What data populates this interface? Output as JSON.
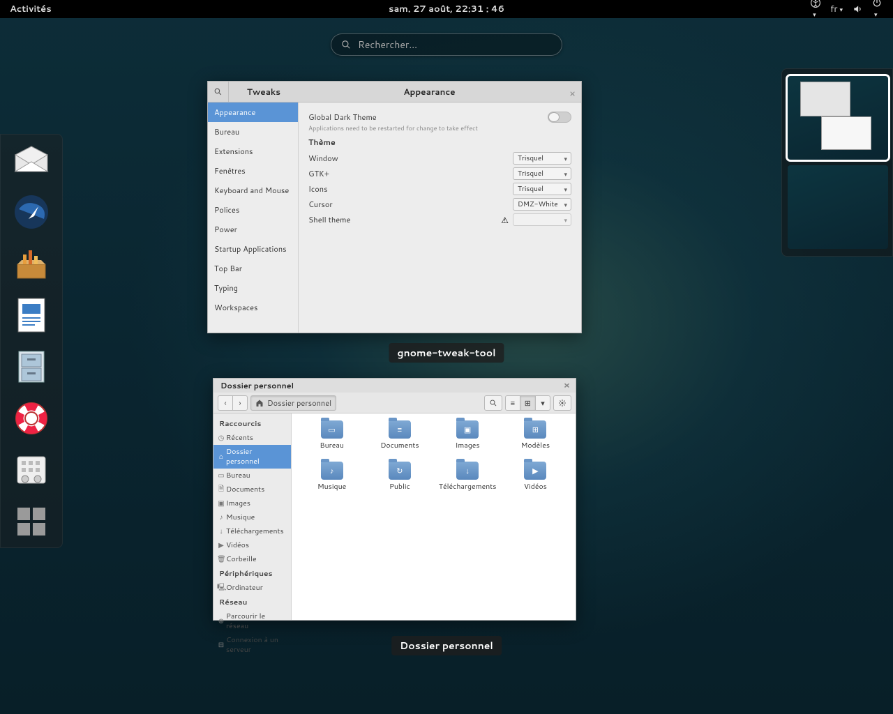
{
  "topbar": {
    "activities": "Activités",
    "clock": "sam. 27 août, 22:31 : 46",
    "lang": "fr"
  },
  "search": {
    "placeholder": "Rechercher..."
  },
  "tweaks": {
    "app_title": "Tweaks",
    "page_title": "Appearance",
    "label": "gnome-tweak-tool",
    "categories": [
      "Appearance",
      "Bureau",
      "Extensions",
      "Fenêtres",
      "Keyboard and Mouse",
      "Polices",
      "Power",
      "Startup Applications",
      "Top Bar",
      "Typing",
      "Workspaces"
    ],
    "global_dark": "Global Dark Theme",
    "global_dark_note": "Applications need to be restarted for change to take effect",
    "theme_header": "Thème",
    "rows": {
      "window": {
        "label": "Window",
        "value": "Trisquel"
      },
      "gtk": {
        "label": "GTK+",
        "value": "Trisquel"
      },
      "icons": {
        "label": "Icons",
        "value": "Trisquel"
      },
      "cursor": {
        "label": "Cursor",
        "value": "DMZ-White"
      },
      "shell": {
        "label": "Shell theme",
        "value": ""
      }
    }
  },
  "files": {
    "title": "Dossier personnel",
    "label": "Dossier personnel",
    "path_button": "Dossier personnel",
    "side": {
      "shortcuts": "Raccourcis",
      "recent": "Récents",
      "home": "Dossier personnel",
      "desktop": "Bureau",
      "documents": "Documents",
      "images": "Images",
      "music": "Musique",
      "downloads": "Téléchargements",
      "videos": "Vidéos",
      "trash": "Corbeille",
      "devices": "Périphériques",
      "computer": "Ordinateur",
      "network": "Réseau",
      "browse": "Parcourir le réseau",
      "connect": "Connexion à un serveur"
    },
    "folders": [
      {
        "name": "Bureau",
        "emblem": "▭"
      },
      {
        "name": "Documents",
        "emblem": "≡"
      },
      {
        "name": "Images",
        "emblem": "▣"
      },
      {
        "name": "Modèles",
        "emblem": "⊞"
      },
      {
        "name": "Musique",
        "emblem": "♪"
      },
      {
        "name": "Public",
        "emblem": "↻"
      },
      {
        "name": "Téléchargements",
        "emblem": "↓"
      },
      {
        "name": "Vidéos",
        "emblem": "▶"
      }
    ]
  }
}
